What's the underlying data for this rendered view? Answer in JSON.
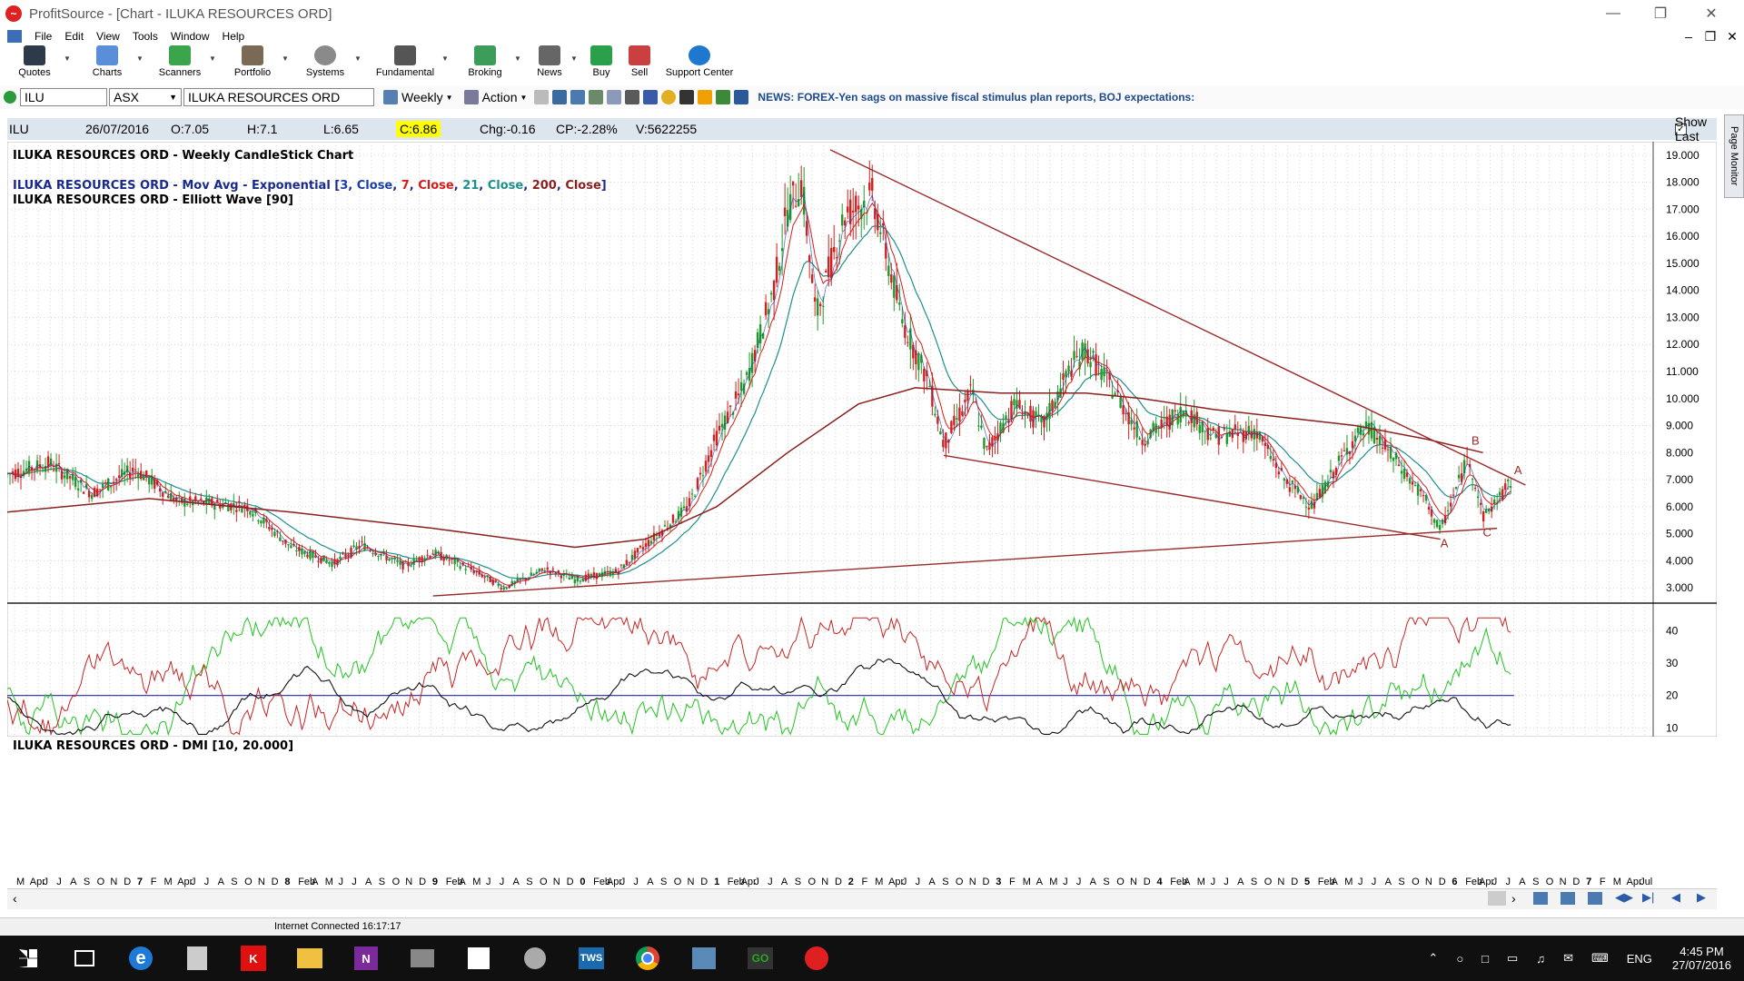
{
  "window": {
    "title": "ProfitSource - [Chart - ILUKA RESOURCES ORD]"
  },
  "menu": [
    "File",
    "Edit",
    "View",
    "Tools",
    "Window",
    "Help"
  ],
  "toolbar": [
    "Quotes",
    "Charts",
    "Scanners",
    "Portfolio",
    "Systems",
    "Fundamental",
    "Broking",
    "News",
    "Buy",
    "Sell",
    "Support Center"
  ],
  "symbol": {
    "code": "ILU",
    "exchange": "ASX",
    "name": "ILUKA RESOURCES ORD",
    "period": "Weekly",
    "action": "Action"
  },
  "news": "NEWS: FOREX-Yen sags on massive fiscal stimulus plan reports, BOJ expectations:",
  "quote": {
    "symbol": "ILU",
    "date": "26/07/2016",
    "open": "O:7.05",
    "high": "H:7.1",
    "low": "L:6.65",
    "close": "C:6.86",
    "change": "Chg:-0.16",
    "change_pct": "CP:-2.28%",
    "volume": "V:5622255",
    "show_last": "Show Last"
  },
  "page_monitor": "Page Monitor",
  "chart_labels": {
    "line1": "ILUKA RESOURCES ORD - Weekly CandleStick Chart",
    "line2_prefix": "ILUKA RESOURCES ORD - Mov Avg - Exponential [",
    "ma3": "3",
    "ma3c": "Close",
    "ma7": "7",
    "ma7c": "Close",
    "ma21": "21",
    "ma21c": "Close",
    "ma200": "200",
    "ma200c": "Close",
    "line3": "ILUKA RESOURCES ORD - Elliott Wave [90]",
    "dmi": "ILUKA RESOURCES ORD - DMI [10, 20.000]"
  },
  "wave_labels": {
    "b": "B",
    "a1": "A",
    "c": "C",
    "a2": "A"
  },
  "status": {
    "connection": "Internet Connected 16:17:17"
  },
  "taskbar": {
    "time": "4:45 PM",
    "date": "27/07/2016",
    "lang": "ENG"
  },
  "colors": {
    "up": "#1f9a2a",
    "down": "#d02020",
    "ma3": "#1a3fa8",
    "ma7": "#d81c1c",
    "ma21": "#1e8f8f",
    "ma200": "#8b1f1f",
    "trend": "#9b2a2a",
    "dmi_plus": "#21c421",
    "dmi_minus": "#c82424",
    "adx": "#111111",
    "dmi_ref": "#2a2ab0"
  },
  "chart_data": [
    {
      "type": "candlestick",
      "title": "ILUKA RESOURCES ORD - Weekly CandleStick Chart",
      "ylim": [
        2.5,
        19.5
      ],
      "yticks": [
        "19.000",
        "18.000",
        "17.000",
        "16.000",
        "15.000",
        "14.000",
        "13.000",
        "12.000",
        "11.000",
        "10.000",
        "9.000",
        "8.000",
        "7.000",
        "6.000",
        "5.000",
        "4.000",
        "3.000"
      ],
      "close_path": [
        [
          2006.0,
          7.2
        ],
        [
          2006.3,
          7.6
        ],
        [
          2006.6,
          6.5
        ],
        [
          2006.9,
          7.4
        ],
        [
          2007.2,
          6.2
        ],
        [
          2007.5,
          6.1
        ],
        [
          2007.7,
          6.0
        ],
        [
          2008.0,
          4.5
        ],
        [
          2008.3,
          3.9
        ],
        [
          2008.5,
          4.6
        ],
        [
          2008.8,
          3.8
        ],
        [
          2009.0,
          4.3
        ],
        [
          2009.3,
          3.6
        ],
        [
          2009.5,
          3.0
        ],
        [
          2009.8,
          3.7
        ],
        [
          2010.0,
          3.3
        ],
        [
          2010.3,
          3.6
        ],
        [
          2010.5,
          4.6
        ],
        [
          2010.8,
          6.0
        ],
        [
          2011.0,
          8.6
        ],
        [
          2011.2,
          10.5
        ],
        [
          2011.4,
          14.0
        ],
        [
          2011.5,
          17.0
        ],
        [
          2011.6,
          18.0
        ],
        [
          2011.7,
          13.0
        ],
        [
          2011.9,
          16.8
        ],
        [
          2012.1,
          17.5
        ],
        [
          2012.3,
          13.0
        ],
        [
          2012.5,
          10.5
        ],
        [
          2012.6,
          8.3
        ],
        [
          2012.8,
          10.3
        ],
        [
          2012.9,
          8.0
        ],
        [
          2013.1,
          9.8
        ],
        [
          2013.3,
          9.0
        ],
        [
          2013.5,
          11.2
        ],
        [
          2013.6,
          11.8
        ],
        [
          2013.8,
          10.3
        ],
        [
          2014.0,
          8.5
        ],
        [
          2014.3,
          9.6
        ],
        [
          2014.5,
          8.6
        ],
        [
          2014.8,
          8.8
        ],
        [
          2015.0,
          7.0
        ],
        [
          2015.2,
          6.0
        ],
        [
          2015.5,
          8.6
        ],
        [
          2015.6,
          8.9
        ],
        [
          2015.8,
          7.6
        ],
        [
          2016.0,
          6.2
        ],
        [
          2016.1,
          5.1
        ],
        [
          2016.3,
          7.9
        ],
        [
          2016.4,
          5.6
        ],
        [
          2016.6,
          6.9
        ]
      ],
      "ma200_path": [
        [
          2006.0,
          5.8
        ],
        [
          2007.0,
          6.3
        ],
        [
          2008.0,
          5.8
        ],
        [
          2009.0,
          5.2
        ],
        [
          2010.0,
          4.5
        ],
        [
          2010.5,
          4.8
        ],
        [
          2011.0,
          6.0
        ],
        [
          2011.5,
          8.0
        ],
        [
          2012.0,
          9.8
        ],
        [
          2012.4,
          10.4
        ],
        [
          2013.0,
          10.2
        ],
        [
          2013.6,
          10.2
        ],
        [
          2014.0,
          10.0
        ],
        [
          2014.5,
          9.6
        ],
        [
          2015.0,
          9.3
        ],
        [
          2015.5,
          9.0
        ],
        [
          2016.0,
          8.5
        ],
        [
          2016.4,
          8.0
        ]
      ],
      "trendlines": [
        {
          "from": [
            2011.8,
            19.2
          ],
          "to": [
            2016.7,
            6.8
          ]
        },
        {
          "from": [
            2012.6,
            7.9
          ],
          "to": [
            2016.1,
            4.8
          ]
        },
        {
          "from": [
            2009.0,
            2.7
          ],
          "to": [
            2016.5,
            5.2
          ]
        }
      ]
    },
    {
      "type": "line",
      "title": "ILUKA RESOURCES ORD - DMI [10, 20.000]",
      "ylim": [
        7,
        48
      ],
      "yticks": [
        "40",
        "30",
        "20",
        "10"
      ],
      "reference": 20
    }
  ],
  "time_axis": [
    "M",
    "Apr",
    "J",
    "J",
    "A",
    "S",
    "O",
    "N",
    "D",
    "7",
    "F",
    "M",
    "Apr",
    "J",
    "J",
    "A",
    "S",
    "O",
    "N",
    "D",
    "8",
    "Feb",
    "A",
    "M",
    "J",
    "J",
    "A",
    "S",
    "O",
    "N",
    "D",
    "9",
    "Feb",
    "A",
    "M",
    "J",
    "J",
    "A",
    "S",
    "O",
    "N",
    "D",
    "0",
    "Feb",
    "Apr",
    "J",
    "J",
    "A",
    "S",
    "O",
    "N",
    "D",
    "1",
    "Feb",
    "Apr",
    "J",
    "J",
    "A",
    "S",
    "O",
    "N",
    "D",
    "2",
    "F",
    "M",
    "Apr",
    "J",
    "J",
    "A",
    "S",
    "O",
    "N",
    "D",
    "3",
    "F",
    "M",
    "A",
    "M",
    "J",
    "J",
    "A",
    "S",
    "O",
    "N",
    "D",
    "4",
    "Feb",
    "A",
    "M",
    "J",
    "J",
    "A",
    "S",
    "O",
    "N",
    "D",
    "5",
    "Feb",
    "A",
    "M",
    "J",
    "J",
    "A",
    "S",
    "O",
    "N",
    "D",
    "6",
    "Feb",
    "Apr",
    "J",
    "J",
    "A",
    "S",
    "O",
    "N",
    "D",
    "7",
    "F",
    "M",
    "Apr",
    "Jul"
  ]
}
